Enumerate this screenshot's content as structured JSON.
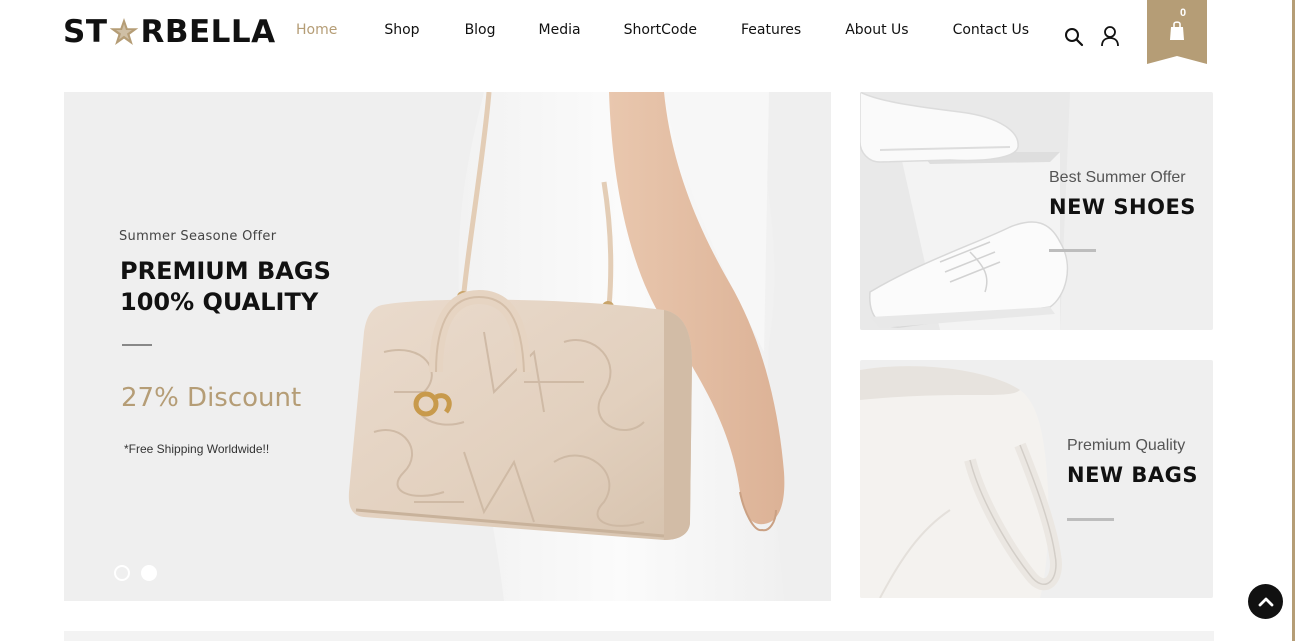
{
  "brand": {
    "logo_left": "ST",
    "logo_right": "RBELLA",
    "logo_star_color": "#b59d76"
  },
  "nav": {
    "items": [
      {
        "label": "Home",
        "active": true
      },
      {
        "label": "Shop",
        "active": false
      },
      {
        "label": "Blog",
        "active": false
      },
      {
        "label": "Media",
        "active": false
      },
      {
        "label": "ShortCode",
        "active": false
      },
      {
        "label": "Features",
        "active": false
      },
      {
        "label": "About Us",
        "active": false
      },
      {
        "label": "Contact Us",
        "active": false
      }
    ]
  },
  "header_icons": {
    "search": "search-icon",
    "account": "user-icon",
    "cart": "shopping-bag-icon"
  },
  "cart": {
    "count": "0"
  },
  "hero": {
    "subtitle": "Summer Seasone Offer",
    "title_line1": "PREMIUM BAGS",
    "title_line2": "100% QUALITY",
    "discount": "27% Discount",
    "note": "*Free Shipping Worldwide!!",
    "slides": 2,
    "active_slide": 2
  },
  "banners": [
    {
      "subtitle": "Best Summer Offer",
      "title": "NEW SHOES"
    },
    {
      "subtitle": "Premium Quality",
      "title": "NEW BAGS"
    }
  ],
  "colors": {
    "accent": "#b59d76",
    "text": "#111111",
    "panel_bg": "#efefef"
  }
}
